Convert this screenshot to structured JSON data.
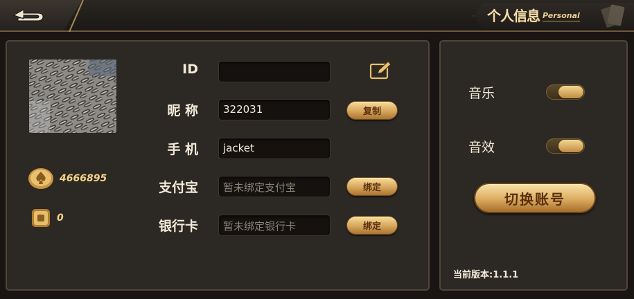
{
  "header": {
    "title_cn": "个人信息",
    "title_en": "Personal"
  },
  "profile": {
    "coins": "4666895",
    "cards": "0"
  },
  "fields": {
    "id": {
      "label": "ID",
      "value": ""
    },
    "nickname": {
      "label": "昵 称",
      "value": "322031",
      "action": "复制"
    },
    "phone": {
      "label": "手 机",
      "value": "jacket"
    },
    "alipay": {
      "label": "支付宝",
      "placeholder": "暂未绑定支付宝",
      "action": "绑定"
    },
    "bank": {
      "label": "银行卡",
      "placeholder": "暂未绑定银行卡",
      "action": "绑定"
    }
  },
  "settings": {
    "music": {
      "label": "音乐",
      "on": true
    },
    "sfx": {
      "label": "音效",
      "on": true
    },
    "switch_account": "切换账号",
    "version": "当前版本:1.1.1"
  },
  "icons": {
    "back": "back-arrow-icon",
    "edit": "edit-icon",
    "coin": "coin-icon",
    "card": "room-card-icon"
  },
  "colors": {
    "gold": "#f5d487",
    "panel": "#2c2824",
    "background": "#181512",
    "text": "#f2ead8"
  }
}
